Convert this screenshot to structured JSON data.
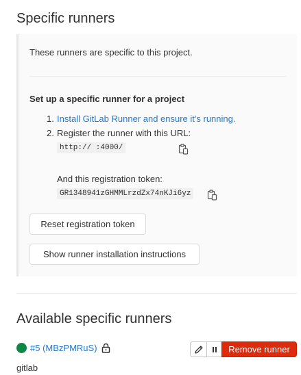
{
  "specific_runners": {
    "title": "Specific runners",
    "intro": "These runners are specific to this project.",
    "setup_title": "Set up a specific runner for a project",
    "steps": [
      {
        "num": "1.",
        "text": "Install GitLab Runner and ensure it's running."
      },
      {
        "num": "2.",
        "text": "Register the runner with this URL:"
      }
    ],
    "url_value": "http://                    :4000/",
    "token_label": "And this registration token:",
    "token_value": "GR1348941zGHMMLrzdZx74nKJi6yz",
    "reset_button": "Reset registration token",
    "instructions_button": "Show runner installation instructions"
  },
  "available_runners": {
    "title": "Available specific runners",
    "runner": {
      "name": "#5 (MBzPMRuS)",
      "description": "gitlab",
      "status_color": "#108548"
    },
    "remove_label": "Remove runner"
  },
  "icons": {
    "copy": "copy-to-clipboard-icon",
    "lock": "lock-icon",
    "edit": "pencil-icon",
    "pause": "pause-icon"
  },
  "colors": {
    "link": "#1f78d1",
    "danger": "#dd2b0e",
    "success": "#108548"
  }
}
